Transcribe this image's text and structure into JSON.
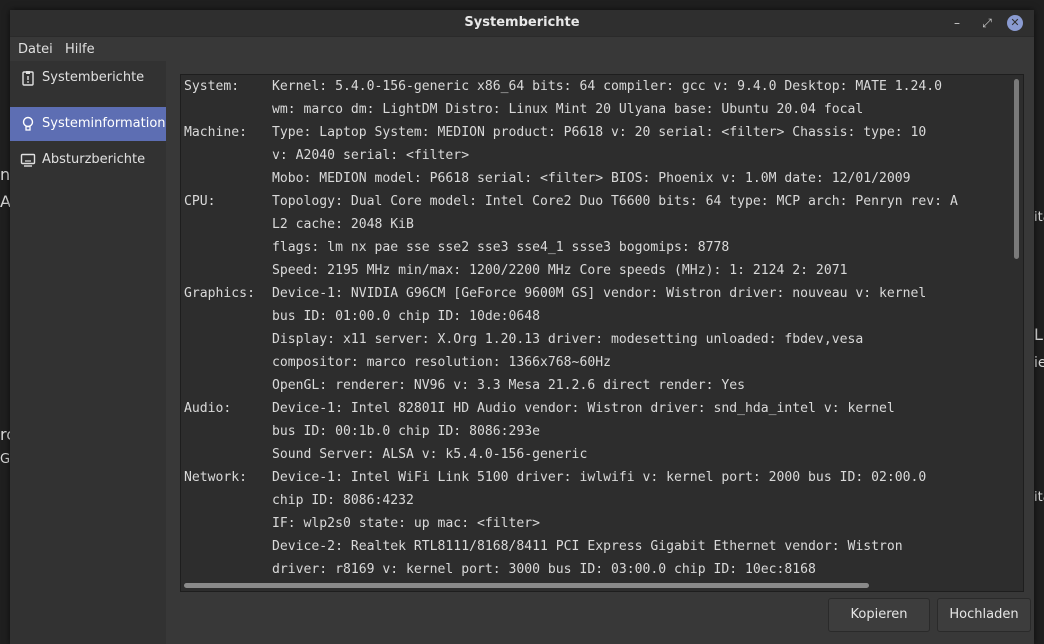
{
  "window": {
    "title": "Systemberichte",
    "controls": {
      "minimize": "–",
      "restore": "⤢",
      "close": "✕"
    }
  },
  "menu": [
    "Datei",
    "Hilfe"
  ],
  "sidebar": {
    "items": [
      {
        "label": "Systemberichte",
        "icon": "report-icon",
        "active": false
      },
      {
        "label": "Systeminformation",
        "icon": "lightbulb-icon",
        "active": true
      },
      {
        "label": "Absturzberichte",
        "icon": "monitor-icon",
        "active": false
      }
    ]
  },
  "report": {
    "lines": [
      {
        "key": "System:",
        "text": "Kernel: 5.4.0-156-generic x86_64 bits: 64 compiler: gcc v: 9.4.0 Desktop: MATE 1.24.0"
      },
      {
        "key": "",
        "text": "wm: marco dm: LightDM Distro: Linux Mint 20 Ulyana base: Ubuntu 20.04 focal"
      },
      {
        "key": "Machine:",
        "text": "Type: Laptop System: MEDION product: P6618 v: 20 serial: <filter> Chassis: type: 10"
      },
      {
        "key": "",
        "text": "v: A2040 serial: <filter>"
      },
      {
        "key": "",
        "text": "Mobo: MEDION model: P6618 serial: <filter> BIOS: Phoenix v: 1.0M date: 12/01/2009"
      },
      {
        "key": "CPU:",
        "text": "Topology: Dual Core model: Intel Core2 Duo T6600 bits: 64 type: MCP arch: Penryn rev: A"
      },
      {
        "key": "",
        "text": "L2 cache: 2048 KiB"
      },
      {
        "key": "",
        "text": "flags: lm nx pae sse sse2 sse3 sse4_1 ssse3 bogomips: 8778"
      },
      {
        "key": "",
        "text": "Speed: 2195 MHz min/max: 1200/2200 MHz Core speeds (MHz): 1: 2124 2: 2071"
      },
      {
        "key": "Graphics:",
        "text": "Device-1: NVIDIA G96CM [GeForce 9600M GS] vendor: Wistron driver: nouveau v: kernel"
      },
      {
        "key": "",
        "text": "bus ID: 01:00.0 chip ID: 10de:0648"
      },
      {
        "key": "",
        "text": "Display: x11 server: X.Org 1.20.13 driver: modesetting unloaded: fbdev,vesa"
      },
      {
        "key": "",
        "text": "compositor: marco resolution: 1366x768~60Hz"
      },
      {
        "key": "",
        "text": "OpenGL: renderer: NV96 v: 3.3 Mesa 21.2.6 direct render: Yes"
      },
      {
        "key": "Audio:",
        "text": "Device-1: Intel 82801I HD Audio vendor: Wistron driver: snd_hda_intel v: kernel"
      },
      {
        "key": "",
        "text": "bus ID: 00:1b.0 chip ID: 8086:293e"
      },
      {
        "key": "",
        "text": "Sound Server: ALSA v: k5.4.0-156-generic"
      },
      {
        "key": "Network:",
        "text": "Device-1: Intel WiFi Link 5100 driver: iwlwifi v: kernel port: 2000 bus ID: 02:00.0"
      },
      {
        "key": "",
        "text": "chip ID: 8086:4232"
      },
      {
        "key": "",
        "text": "IF: wlp2s0 state: up mac: <filter>"
      },
      {
        "key": "",
        "text": "Device-2: Realtek RTL8111/8168/8411 PCI Express Gigabit Ethernet vendor: Wistron"
      },
      {
        "key": "",
        "text": "driver: r8169 v: kernel port: 3000 bus ID: 03:00.0 chip ID: 10ec:8168"
      }
    ]
  },
  "buttons": {
    "copy": "Kopieren",
    "upload": "Hochladen"
  },
  "background": {
    "fragments": [
      "ni",
      "A",
      "o",
      "rc",
      "Gr",
      "I",
      "ita",
      "L",
      "ie",
      "ita"
    ]
  },
  "colors": {
    "accent": "#5d6eb3",
    "close": "#8a9bd1"
  }
}
